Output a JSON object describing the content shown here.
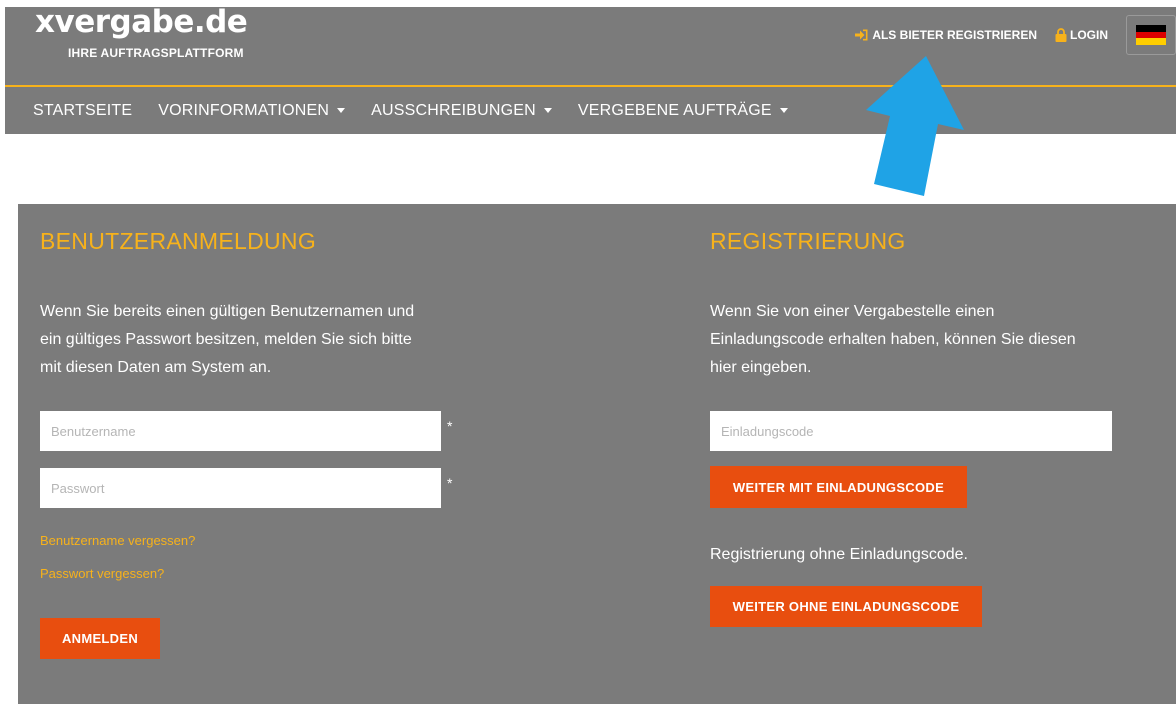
{
  "header": {
    "logo": "xvergabe.de",
    "tagline": "IHRE AUFTRAGSPLATTFORM",
    "register_link": "ALS BIETER REGISTRIEREN",
    "login_link": "LOGIN",
    "language_icon": "german-flag-icon"
  },
  "nav": {
    "items": [
      {
        "label": "STARTSEITE"
      },
      {
        "label": "VORINFORMATIONEN"
      },
      {
        "label": "AUSSCHREIBUNGEN"
      },
      {
        "label": "VERGEBENE AUFTRÄGE"
      }
    ]
  },
  "login": {
    "title": "BENUTZERANMELDUNG",
    "desc_lines": [
      "Wenn Sie bereits einen gültigen Benutzernamen und",
      "ein gültiges Passwort besitzen, melden Sie sich bitte",
      "mit diesen Daten am System an."
    ],
    "username_placeholder": "Benutzername",
    "password_placeholder": "Passwort",
    "required_mark": "*",
    "forgot_username": "Benutzername vergessen?",
    "forgot_password": "Passwort vergessen?",
    "submit_label": "ANMELDEN"
  },
  "register": {
    "title": "REGISTRIERUNG",
    "desc_lines": [
      "Wenn Sie von einer Vergabestelle einen",
      "Einladungscode erhalten haben, können Sie diesen",
      "hier eingeben."
    ],
    "code_placeholder": "Einladungscode",
    "with_code_label": "WEITER MIT EINLADUNGSCODE",
    "without_code_text": "Registrierung ohne Einladungscode.",
    "without_code_label": "WEITER OHNE EINLADUNGSCODE"
  },
  "colors": {
    "panel_bg": "#7b7b7b",
    "accent": "#f7b21b",
    "button": "#e84e0f",
    "annotation_arrow": "#1fa3e6"
  }
}
